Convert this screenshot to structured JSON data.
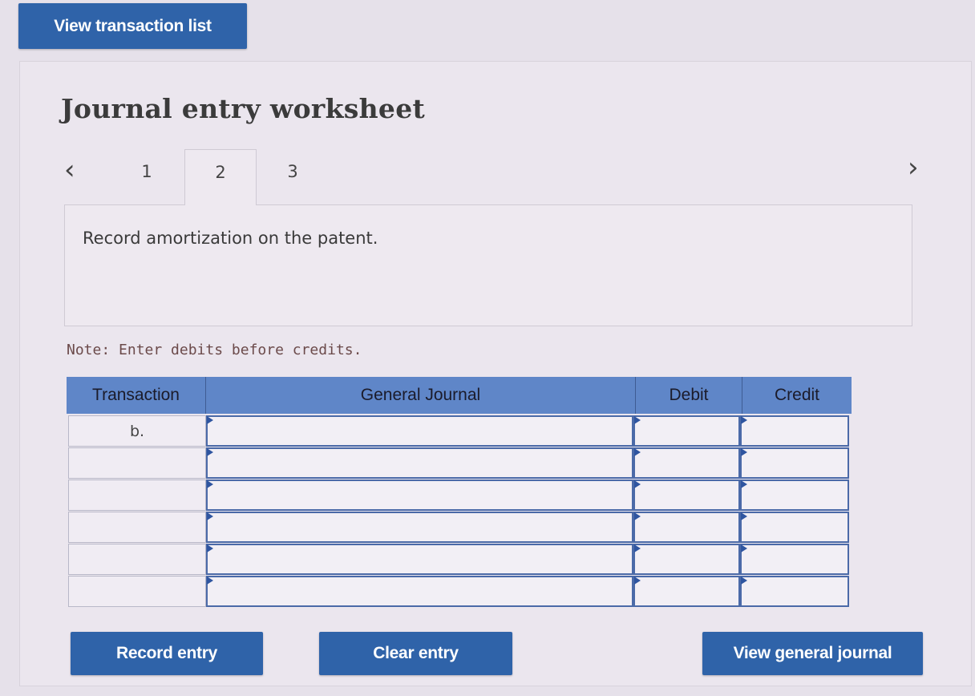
{
  "top_button": {
    "label": "View transaction list"
  },
  "worksheet": {
    "title": "Journal entry worksheet",
    "tabs": [
      {
        "label": "1"
      },
      {
        "label": "2",
        "active": true
      },
      {
        "label": "3"
      }
    ],
    "prev_icon": "chevron-left-icon",
    "next_icon": "chevron-right-icon",
    "description": "Record amortization on the patent.",
    "note": "Note: Enter debits before credits."
  },
  "table": {
    "headers": {
      "transaction": "Transaction",
      "general_journal": "General Journal",
      "debit": "Debit",
      "credit": "Credit"
    },
    "rows": [
      {
        "transaction": "b.",
        "general_journal": "",
        "debit": "",
        "credit": ""
      },
      {
        "transaction": "",
        "general_journal": "",
        "debit": "",
        "credit": ""
      },
      {
        "transaction": "",
        "general_journal": "",
        "debit": "",
        "credit": ""
      },
      {
        "transaction": "",
        "general_journal": "",
        "debit": "",
        "credit": ""
      },
      {
        "transaction": "",
        "general_journal": "",
        "debit": "",
        "credit": ""
      },
      {
        "transaction": "",
        "general_journal": "",
        "debit": "",
        "credit": ""
      }
    ]
  },
  "buttons": {
    "record_entry": "Record entry",
    "clear_entry": "Clear entry",
    "view_general_journal": "View general journal"
  },
  "colors": {
    "button_blue": "#2f63a9",
    "header_blue": "#5f86c8",
    "cell_border": "#4b6aa8"
  }
}
